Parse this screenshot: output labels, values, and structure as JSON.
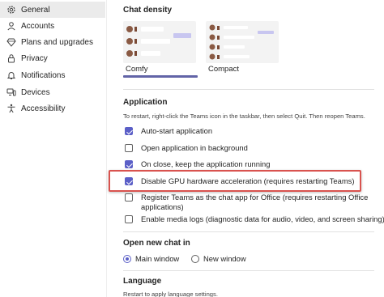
{
  "sidebar": {
    "items": [
      {
        "label": "General",
        "icon": "gear-icon",
        "active": true
      },
      {
        "label": "Accounts",
        "icon": "person-icon"
      },
      {
        "label": "Plans and upgrades",
        "icon": "diamond-icon"
      },
      {
        "label": "Privacy",
        "icon": "lock-icon"
      },
      {
        "label": "Notifications",
        "icon": "bell-icon"
      },
      {
        "label": "Devices",
        "icon": "devices-icon"
      },
      {
        "label": "Accessibility",
        "icon": "accessibility-icon"
      }
    ]
  },
  "chat_density": {
    "title": "Chat density",
    "options": [
      {
        "label": "Comfy",
        "selected": true
      },
      {
        "label": "Compact",
        "selected": false
      }
    ]
  },
  "application": {
    "title": "Application",
    "hint": "To restart, right-click the Teams icon in the taskbar, then select Quit. Then reopen Teams.",
    "options": [
      {
        "label": "Auto-start application",
        "checked": true
      },
      {
        "label": "Open application in background",
        "checked": false
      },
      {
        "label": "On close, keep the application running",
        "checked": true
      },
      {
        "label": "Disable GPU hardware acceleration (requires restarting Teams)",
        "checked": true
      },
      {
        "label": "Register Teams as the chat app for Office (requires restarting Office",
        "label_line2": "applications)",
        "checked": false
      },
      {
        "label": "Enable media logs (diagnostic data for audio, video, and screen sharing)",
        "checked": false
      }
    ]
  },
  "open_new_chat": {
    "title": "Open new chat in",
    "options": [
      {
        "label": "Main window",
        "selected": true
      },
      {
        "label": "New window",
        "selected": false
      }
    ]
  },
  "language": {
    "title": "Language",
    "hint": "Restart to apply language settings."
  },
  "colors": {
    "accent": "#5b5fc7",
    "highlight_border": "#d9534f",
    "active_nav_bg": "#ebebeb"
  }
}
